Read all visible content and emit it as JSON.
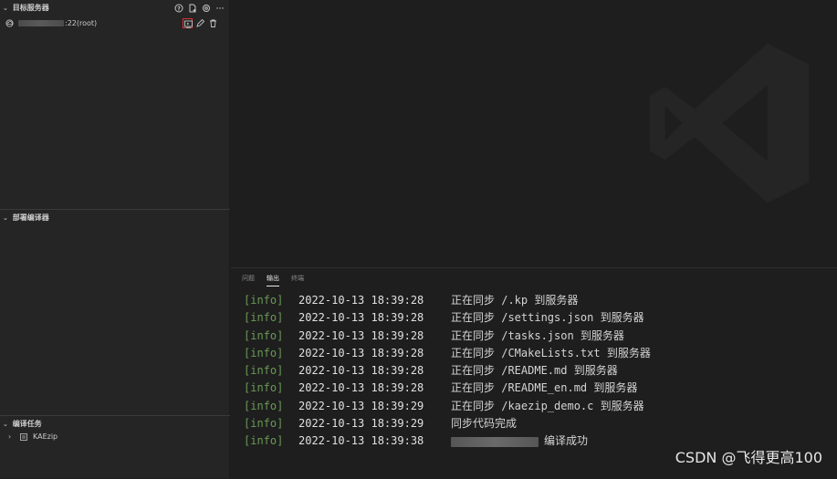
{
  "sidebar": {
    "target_servers": {
      "title": "目标服务器",
      "host_suffix": ":22(root)"
    },
    "deploy_compiler": {
      "title": "部署编译器"
    },
    "compile_tasks": {
      "title": "编译任务",
      "items": [
        {
          "label": "KAEzip"
        }
      ]
    }
  },
  "panel": {
    "tabs": [
      {
        "label": "问题"
      },
      {
        "label": "输出"
      },
      {
        "label": "终端"
      }
    ],
    "active_tab": "输出",
    "log": [
      {
        "tag": "[info]",
        "time": "2022-10-13 18:39:28",
        "message": "正在同步 /.kp 到服务器"
      },
      {
        "tag": "[info]",
        "time": "2022-10-13 18:39:28",
        "message": "正在同步 /settings.json 到服务器"
      },
      {
        "tag": "[info]",
        "time": "2022-10-13 18:39:28",
        "message": "正在同步 /tasks.json 到服务器"
      },
      {
        "tag": "[info]",
        "time": "2022-10-13 18:39:28",
        "message": "正在同步 /CMakeLists.txt 到服务器"
      },
      {
        "tag": "[info]",
        "time": "2022-10-13 18:39:28",
        "message": "正在同步 /README.md 到服务器"
      },
      {
        "tag": "[info]",
        "time": "2022-10-13 18:39:28",
        "message": "正在同步 /README_en.md 到服务器"
      },
      {
        "tag": "[info]",
        "time": "2022-10-13 18:39:29",
        "message": "正在同步 /kaezip_demo.c 到服务器"
      },
      {
        "tag": "[info]",
        "time": "2022-10-13 18:39:29",
        "message": "同步代码完成"
      },
      {
        "tag": "[info]",
        "time": "2022-10-13 18:39:38",
        "message": "编译成功"
      }
    ]
  },
  "watermark": "CSDN @飞得更高100",
  "icons": {
    "server_actions": [
      "help-icon",
      "new-file-icon",
      "settings-icon",
      "more-icon"
    ],
    "row_actions": [
      "connect-terminal-icon",
      "edit-icon",
      "delete-icon"
    ],
    "server": "cloud-icon",
    "task": "task-file-icon",
    "logo": "vscode-logo-icon"
  },
  "colors": {
    "info_tag": "#6a9955",
    "selected_action_border": "#e03030"
  }
}
